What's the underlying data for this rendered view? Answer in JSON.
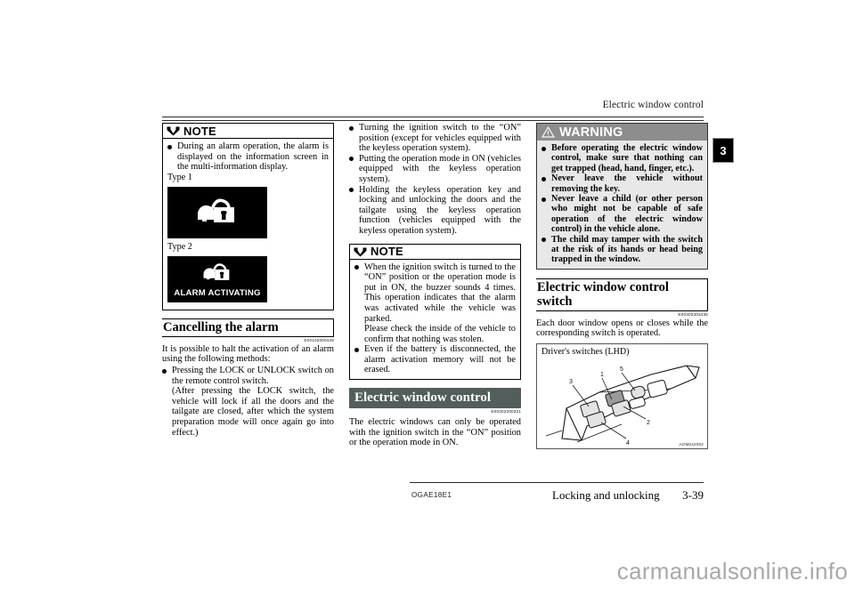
{
  "header": {
    "running_title": "Electric window control",
    "chapter_tab": "3"
  },
  "footer": {
    "doc_code": "OGAE18E1",
    "chapter_title": "Locking and unlocking",
    "page_number": "3-39"
  },
  "watermark": "carmanualsonline.info",
  "colors": {
    "banner_bg": "#525e5b",
    "warning_head_bg": "#8d8d8d",
    "warning_body_bg": "#e8e8e8",
    "lcd_bg": "#000000"
  },
  "column_1": {
    "note_box": {
      "label": "NOTE",
      "icon": "wings-icon",
      "bullet_1": "During an alarm operation, the alarm is displayed on the information screen in the multi-information display.",
      "type1_caption": "Type 1",
      "type2_caption": "Type 2",
      "lcd1_icon": "car-lock-icon",
      "lcd2_icon": "car-lock-icon",
      "lcd2_text": "ALARM ACTIVATING"
    },
    "section": {
      "heading": "Cancelling the alarm",
      "refcode": "E00102000428",
      "lead": "It is possible to halt the activation of an alarm using the following methods:",
      "bullets": [
        {
          "main": "Pressing the LOCK or UNLOCK switch on the remote control switch.",
          "extra": "(After pressing the LOCK switch, the vehicle will lock if all the doors and the tailgate are closed, after which the system preparation mode will once again go into effect.)"
        }
      ]
    }
  },
  "column_2": {
    "bullets": [
      "Turning the ignition switch to the “ON” position (except for vehicles equipped with the keyless operation system).",
      "Putting the operation mode in ON (vehicles equipped with the keyless operation system).",
      "Holding the keyless operation key and locking and unlocking the doors and the tailgate using the keyless operation function (vehicles equipped with the keyless operation system)."
    ],
    "note_box": {
      "label": "NOTE",
      "icon": "wings-icon",
      "bullets": [
        {
          "main": "When the ignition switch is turned to the “ON” position or the operation mode is put in ON, the buzzer sounds 4 times. This operation indicates that the alarm was activated while the vehicle was parked.",
          "extra": "Please check the inside of the vehicle to confirm that nothing was stolen."
        },
        {
          "main": "Even if the battery is disconnected, the alarm activation memory will not be erased.",
          "extra": ""
        }
      ]
    },
    "banner_section": {
      "heading": "Electric window control",
      "refcode": "E00302200321",
      "body": "The electric windows can only be operated with the ignition switch in the “ON” position or the operation mode in ON."
    }
  },
  "column_3": {
    "warning_box": {
      "label": "WARNING",
      "icon": "warning-triangle-icon",
      "bullets": [
        "Before operating the electric window control, make sure that nothing can get trapped (head, hand, finger, etc.).",
        "Never leave the vehicle without removing the key.",
        "Never leave a child (or other person who might not be capable of safe operation of the electric window control) in the vehicle alone.",
        "The child may tamper with the switch at the risk of its hands or head being trapped in the window."
      ]
    },
    "section": {
      "heading": "Electric window control switch",
      "refcode": "E00302303435",
      "body": "Each door window opens or closes while the corresponding switch is operated."
    },
    "illustration": {
      "caption": "Driver's switches (LHD)",
      "image_code": "AGM042002",
      "callouts": [
        "1",
        "2",
        "3",
        "4",
        "5"
      ]
    }
  }
}
